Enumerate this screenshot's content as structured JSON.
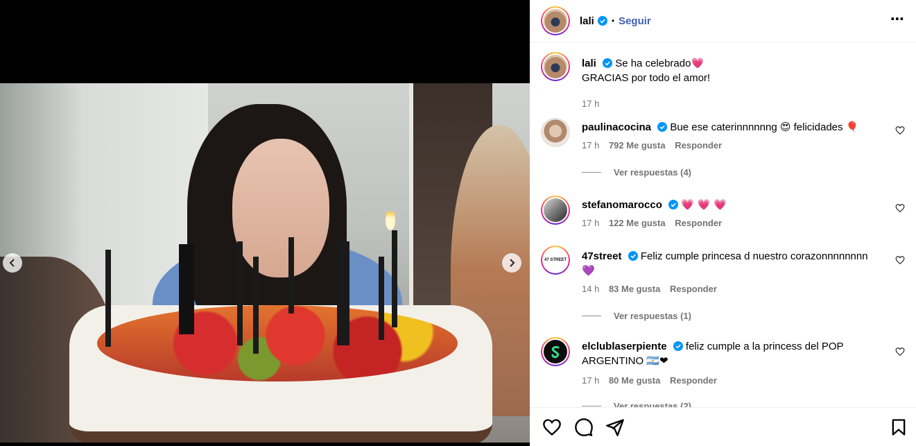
{
  "post": {
    "username": "lali",
    "follow_label": "Seguir",
    "separator": "•",
    "more_label": "⋯"
  },
  "caption": {
    "username": "lali",
    "line1": "Se ha celebrado",
    "emoji1": "💗",
    "line2": "GRACIAS por todo el amor!",
    "time": "17 h"
  },
  "comments": [
    {
      "username": "paulinacocina",
      "text": "Bue ese caterinnnnnng 😍 felicidades 🎈",
      "time": "17 h",
      "likes": "792 Me gusta",
      "reply": "Responder",
      "replies": "Ver respuestas (4)"
    },
    {
      "username": "stefanomarocco",
      "text": "💗 💗 💗",
      "time": "17 h",
      "likes": "122 Me gusta",
      "reply": "Responder"
    },
    {
      "username": "47street",
      "text": "Feliz cumple princesa d nuestro corazonnnnnnnn 💜",
      "time": "14 h",
      "likes": "83 Me gusta",
      "reply": "Responder",
      "replies": "Ver respuestas (1)",
      "avatar_text": "47 STREET"
    },
    {
      "username": "elclublaserpiente",
      "text": "feliz cumple a la princess del POP ARGENTINO 🇦🇷❤",
      "time": "17 h",
      "likes": "80 Me gusta",
      "reply": "Responder",
      "replies": "Ver respuestas (2)"
    }
  ],
  "colors": {
    "verified": "#0095f6",
    "follow": "#3f5fb5",
    "muted": "#737373"
  },
  "icons": {
    "prev": "chevron-left-icon",
    "next": "chevron-right-icon",
    "like": "heart-icon",
    "comment": "comment-icon",
    "share": "send-icon",
    "save": "bookmark-icon"
  }
}
